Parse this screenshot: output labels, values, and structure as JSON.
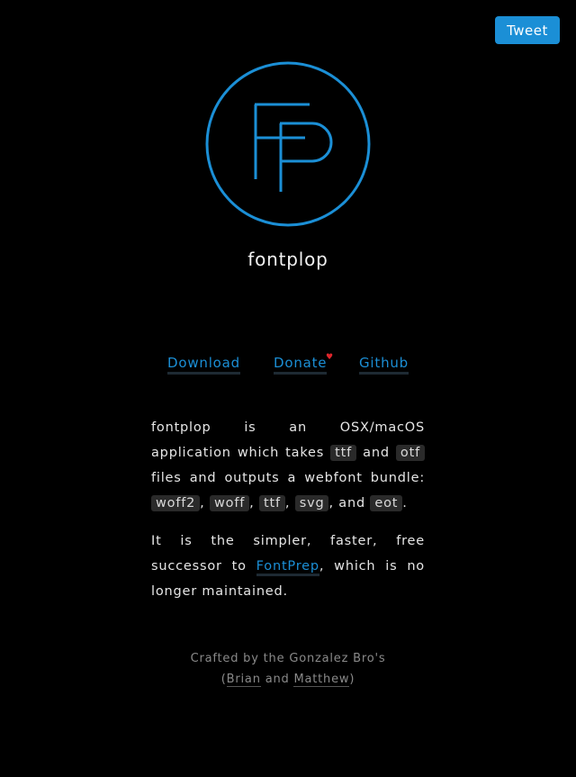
{
  "tweet_label": "Tweet",
  "app_name": "fontplop",
  "nav": {
    "download": "Download",
    "donate": "Donate",
    "donate_marker": "♥",
    "github": "Github"
  },
  "description": {
    "p1_part1": "fontplop is an OSX/macOS application which takes",
    "fmt_ttf_in": "ttf",
    "and1": "and",
    "fmt_otf_in": "otf",
    "p1_part2": "files and outputs a webfont bundle:",
    "fmt_woff2": "woff2",
    "comma1": ",",
    "fmt_woff": "woff",
    "comma2": ",",
    "fmt_ttf_out": "ttf",
    "comma3": ",",
    "fmt_svg": "svg",
    "and2": ", and",
    "fmt_eot": "eot",
    "period": ".",
    "p2_part1": "It is the simpler, faster, free successor to",
    "fontprep_link": "FontPrep",
    "p2_part2": ", which is no longer maintained."
  },
  "footer": {
    "line1": "Crafted by the Gonzalez Bro's",
    "open_paren": "(",
    "brian": "Brian",
    "and": "and",
    "matthew": "Matthew",
    "close_paren": ")"
  },
  "colors": {
    "accent": "#1b8fd6",
    "background": "#000000",
    "heart": "#e0262c"
  }
}
